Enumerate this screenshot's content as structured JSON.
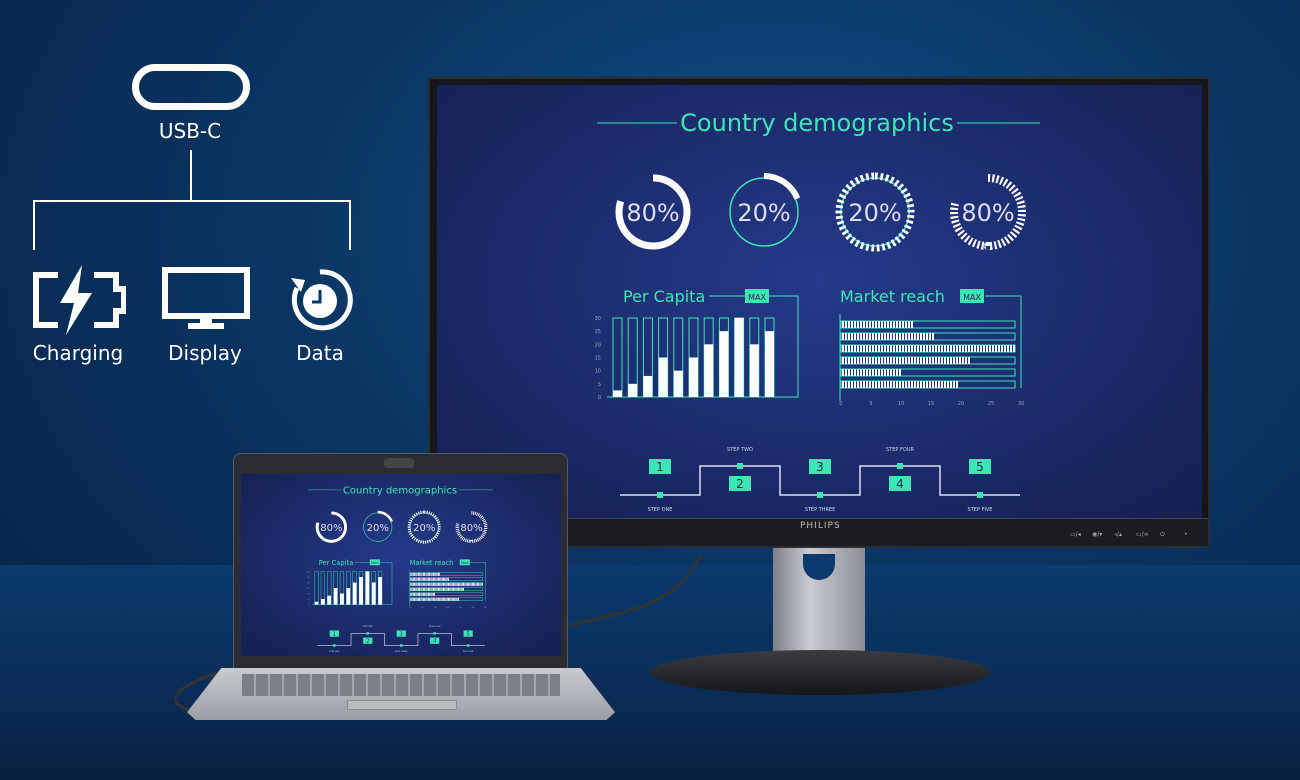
{
  "features": {
    "connector": "USB-C",
    "items": [
      {
        "label": "Charging",
        "icon": "battery-bolt-icon"
      },
      {
        "label": "Display",
        "icon": "monitor-icon"
      },
      {
        "label": "Data",
        "icon": "clock-sync-icon"
      }
    ]
  },
  "monitor": {
    "brand": "PHILIPS",
    "controls": [
      "▭/◂",
      "◉/▾",
      "◃/▴",
      "▭/∞",
      "⏻",
      "•"
    ]
  },
  "screen": {
    "title": "Country demographics",
    "accent": "#3ee6b4",
    "gauges": [
      {
        "value": 80,
        "label": "80%",
        "style": "solid"
      },
      {
        "value": 20,
        "label": "20%",
        "style": "arc"
      },
      {
        "value": 20,
        "label": "20%",
        "style": "dashed-arc"
      },
      {
        "value": 80,
        "label": "80%",
        "style": "dashed"
      }
    ],
    "chart_data": [
      {
        "type": "bar",
        "title": "Per Capita",
        "badge": "MAX",
        "yticks": [
          0,
          5,
          10,
          15,
          20,
          25,
          30
        ],
        "ylim": [
          0,
          30
        ],
        "values": [
          2.5,
          5,
          8,
          15,
          10,
          15,
          20,
          25,
          30,
          20,
          25
        ]
      },
      {
        "type": "bar",
        "orientation": "horizontal",
        "title": "Market reach",
        "badge": "MAX",
        "xticks": [
          0,
          5,
          10,
          15,
          20,
          25,
          30
        ],
        "xlim": [
          0,
          30
        ],
        "values": [
          12,
          15.5,
          29,
          21.5,
          10,
          19.5
        ]
      }
    ],
    "steps": [
      {
        "num": "1",
        "label": "STEP ONE"
      },
      {
        "num": "2",
        "label": "STEP TWO"
      },
      {
        "num": "3",
        "label": "STEP THREE"
      },
      {
        "num": "4",
        "label": "STEP FOUR"
      },
      {
        "num": "5",
        "label": "STEP FIVE"
      }
    ]
  }
}
